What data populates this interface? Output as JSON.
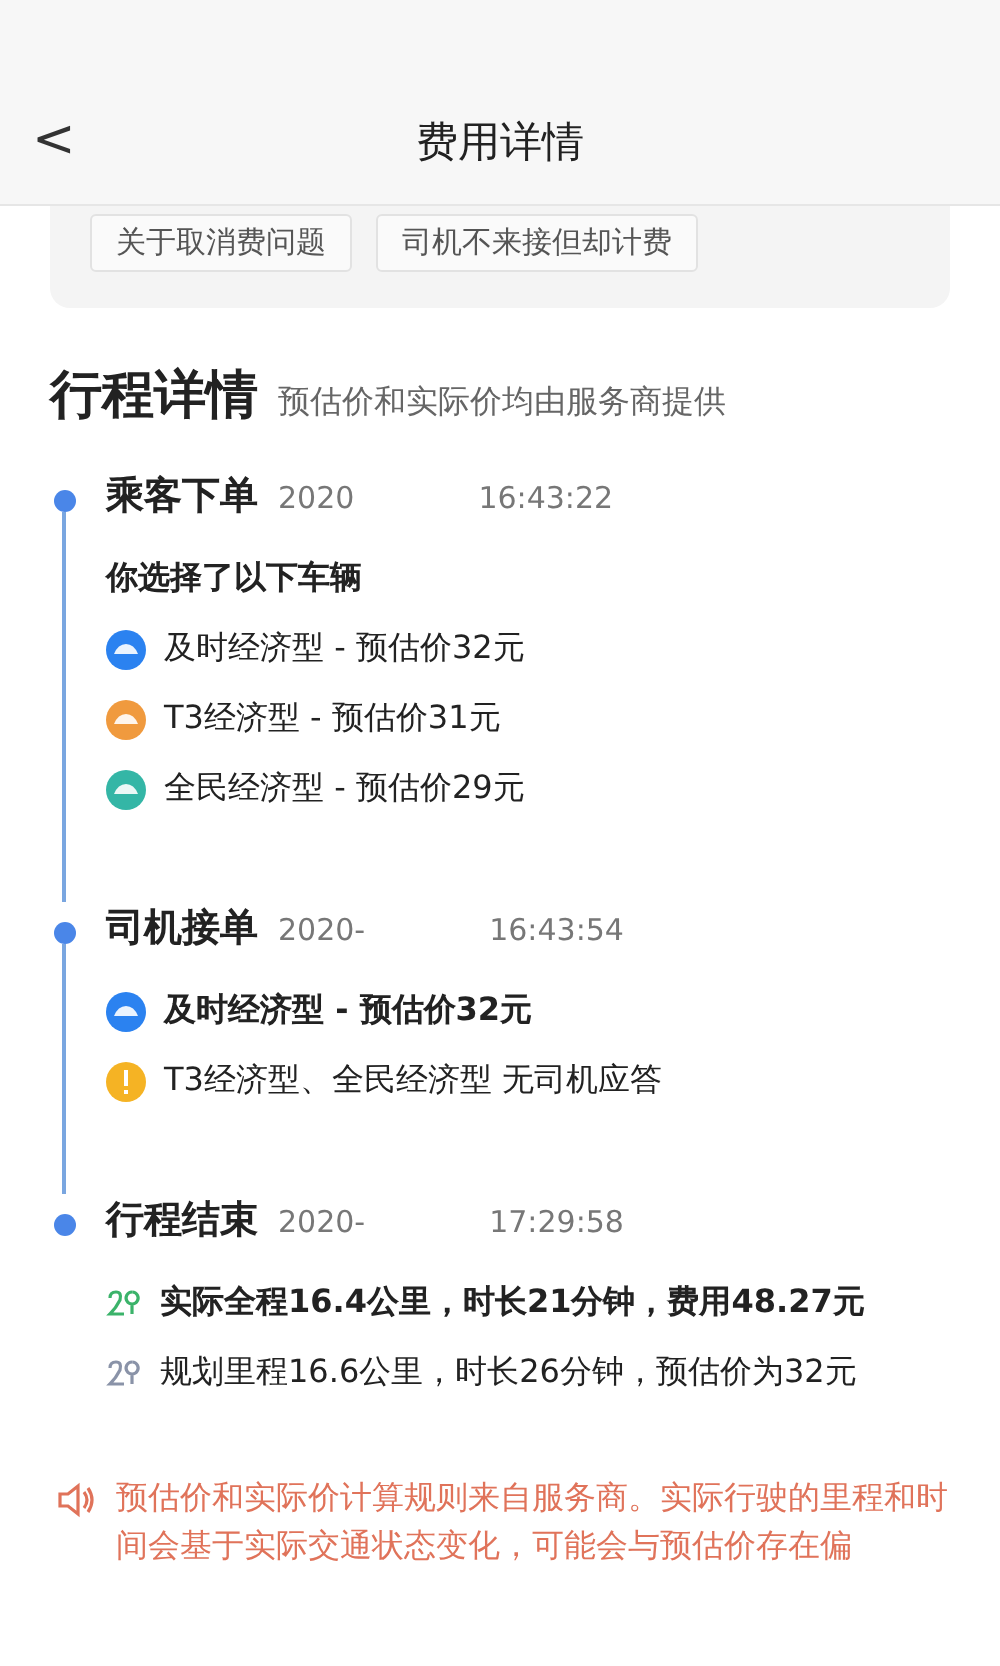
{
  "header": {
    "back": "<",
    "title": "费用详情"
  },
  "help_topics": [
    "关于取消费问题",
    "司机不来接但却计费"
  ],
  "section": {
    "title": "行程详情",
    "subtitle": "预估价和实际价均由服务商提供"
  },
  "stages": [
    {
      "title": "乘客下单",
      "date": "2020",
      "time": "16:43:22",
      "note": "你选择了以下车辆",
      "items": [
        {
          "kind": "option",
          "color": "#2b82f0",
          "text": "及时经济型 - 预估价32元",
          "bold": false
        },
        {
          "kind": "option",
          "color": "#f09a3e",
          "text": "T3经济型 - 预估价31元",
          "bold": false
        },
        {
          "kind": "option",
          "color": "#34b6a6",
          "text": "全民经济型 - 预估价29元",
          "bold": false
        }
      ]
    },
    {
      "title": "司机接单",
      "date": "2020-",
      "time": "16:43:54",
      "items": [
        {
          "kind": "option",
          "color": "#2b82f0",
          "text": "及时经济型 - 预估价32元",
          "bold": true
        },
        {
          "kind": "warning",
          "color": "#f5b324",
          "text": "T3经济型、全民经济型 无司机应答",
          "bold": false
        }
      ]
    },
    {
      "title": "行程结束",
      "date": "2020-",
      "time": "17:29:58",
      "items": [
        {
          "kind": "route",
          "color": "#3bb36a",
          "text": "实际全程16.4公里，时长21分钟，费用48.27元",
          "bold": true
        },
        {
          "kind": "route",
          "color": "#8a93a8",
          "text": "规划里程16.6公里，时长26分钟，预估价为32元",
          "bold": false
        }
      ]
    }
  ],
  "notice": "预估价和实际价计算规则来自服务商。实际行驶的里程和时间会基于实际交通状态变化，可能会与预估价存在偏"
}
